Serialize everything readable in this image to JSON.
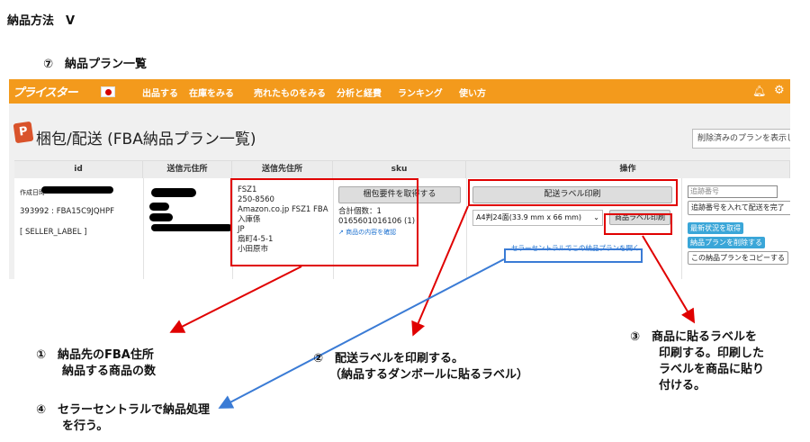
{
  "doc": {
    "title": "納品方法　Ⅴ",
    "subtitle": "⑦　納品プラン一覧"
  },
  "nav": {
    "logo": "プライスター",
    "items": [
      "出品する",
      "在庫をみる",
      "売れたものをみる",
      "分析と経費",
      "ランキング",
      "使い方"
    ]
  },
  "page": {
    "title": "梱包/配送 (FBA納品プラン一覧)",
    "deleted_button": "削除済みのプランを表示し"
  },
  "table": {
    "headers": [
      "id",
      "送信元住所",
      "送信先住所",
      "sku",
      "操作"
    ],
    "row": {
      "created_label": "作成日時",
      "plan_id": "393992 : FBA15C9JQHPF",
      "seller_label": "[ SELLER_LABEL ]",
      "dest_address": [
        "FSZ1",
        "250-8560",
        "Amazon.co.jp FSZ1 FBA",
        "入庫係",
        "JP",
        "扇町4-5-1",
        "小田原市"
      ],
      "sku_button": "梱包要件を取得する",
      "sku_total": "合計個数：1",
      "sku_item": "0165601016106 (1)",
      "sku_link": "商品の内容を確認",
      "ship_label_button": "配送ラベル印刷",
      "label_size_select": "A4判24面(33.9 mm x 66 mm)",
      "product_label_button": "商品ラベル印刷",
      "seller_central_link": "セラーセントラルでこの納品プランを開く",
      "tracking_placeholder": "追跡番号",
      "tracking_button": "追跡番号を入れて配送を完了",
      "status_button": "最新状況を取得",
      "delete_button": "納品プランを削除する",
      "copy_button": "この納品プランをコピーする"
    }
  },
  "annotations": {
    "a1": [
      "①　納品先のFBA住所",
      "納品する商品の数"
    ],
    "a2": [
      "②　配送ラベルを印刷する。",
      "（納品するダンボールに貼るラベル）"
    ],
    "a3": [
      "③　商品に貼るラベルを",
      "印刷する。印刷した",
      "ラベルを商品に貼り",
      "付ける。"
    ],
    "a4": [
      "④　セラーセントラルで納品処理",
      "を行う。"
    ]
  },
  "colors": {
    "nav_bg": "#f39a1c",
    "highlight_red": "#e00000",
    "highlight_blue": "#3a7bd5",
    "link_blue": "#1a6fcf"
  }
}
